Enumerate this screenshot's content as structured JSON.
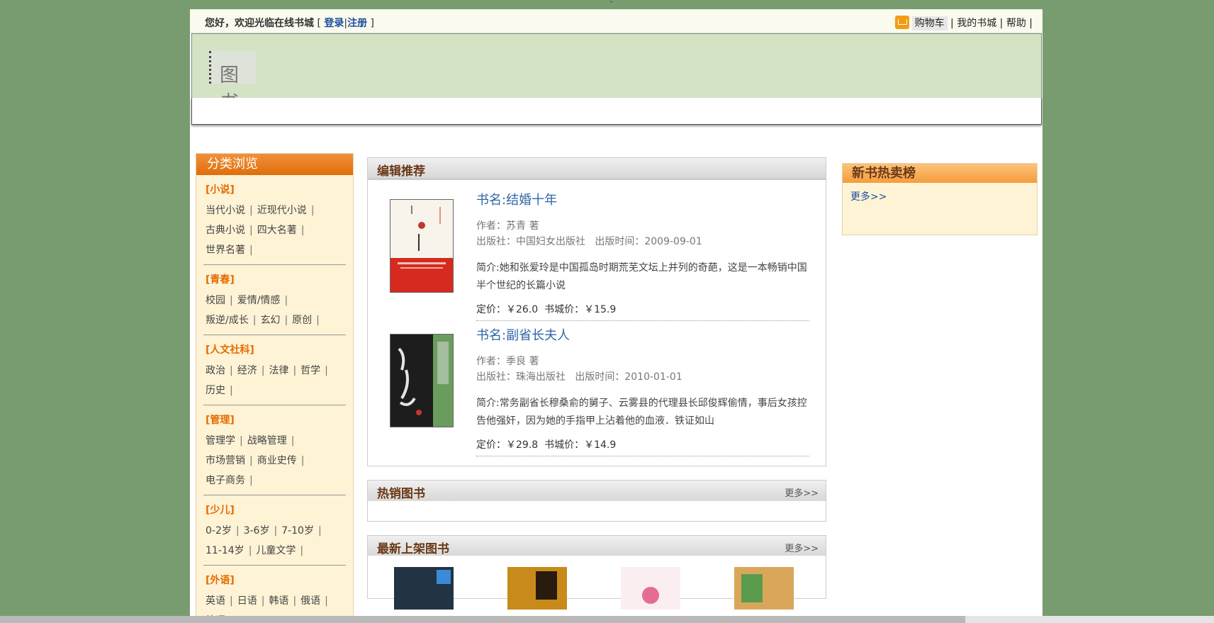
{
  "top": {
    "welcome": "您好，欢迎光临在线书城",
    "bracket_open": "[",
    "login": "登录",
    "bar": "|",
    "register": "注册",
    "bracket_close": "]",
    "cart": "购物车",
    "my_store": "我的书城",
    "help": "帮助",
    "sep": "|"
  },
  "logo": "图书",
  "left": {
    "title": "分类浏览",
    "categories": [
      {
        "title": "[小说]",
        "items": [
          "当代小说",
          "近现代小说",
          "古典小说",
          "四大名著",
          "世界名著"
        ]
      },
      {
        "title": "[青春]",
        "items": [
          "校园",
          "爱情/情感",
          "叛逆/成长",
          "玄幻",
          "原创"
        ]
      },
      {
        "title": "[人文社科]",
        "items": [
          "政治",
          "经济",
          "法律",
          "哲学",
          "历史"
        ]
      },
      {
        "title": "[管理]",
        "items": [
          "管理学",
          "战略管理",
          "市场营销",
          "商业史传",
          "电子商务"
        ]
      },
      {
        "title": "[少儿]",
        "items": [
          "0-2岁",
          "3-6岁",
          "7-10岁",
          "11-14岁",
          "儿童文学"
        ]
      },
      {
        "title": "[外语]",
        "items": [
          "英语",
          "日语",
          "韩语",
          "俄语",
          "德语"
        ]
      }
    ]
  },
  "recommend": {
    "title": "编辑推荐",
    "books": [
      {
        "name": "书名:结婚十年",
        "author": "作者：苏青 著",
        "publisher": "出版社：中国妇女出版社",
        "pubdate": "出版时间：2009-09-01",
        "desc": "简介:她和张爱玲是中国孤岛时期荒芜文坛上并列的奇葩，这是一本畅销中国半个世纪的长篇小说",
        "price": "定价：￥26.0",
        "store_price": "书城价：￥15.9"
      },
      {
        "name": "书名:副省长夫人",
        "author": "作者：季良 著",
        "publisher": "出版社：珠海出版社",
        "pubdate": "出版时间：2010-01-01",
        "desc": "简介:常务副省长穆桑俞的舅子、云雾县的代理县长邱俊辉偷情，事后女孩控告他强奸，因为她的手指甲上沾着他的血液．铁证如山",
        "price": "定价：￥29.8",
        "store_price": "书城价：￥14.9"
      }
    ]
  },
  "hot": {
    "title": "热销图书",
    "more": "更多>>"
  },
  "newest": {
    "title": "最新上架图书",
    "more": "更多>>"
  },
  "right": {
    "title": "新书热卖榜",
    "more": "更多>>"
  },
  "colors": {
    "accent": "#e57a16",
    "link": "#1a4e9b",
    "background": "#789c70",
    "panel": "#fff3d6"
  }
}
